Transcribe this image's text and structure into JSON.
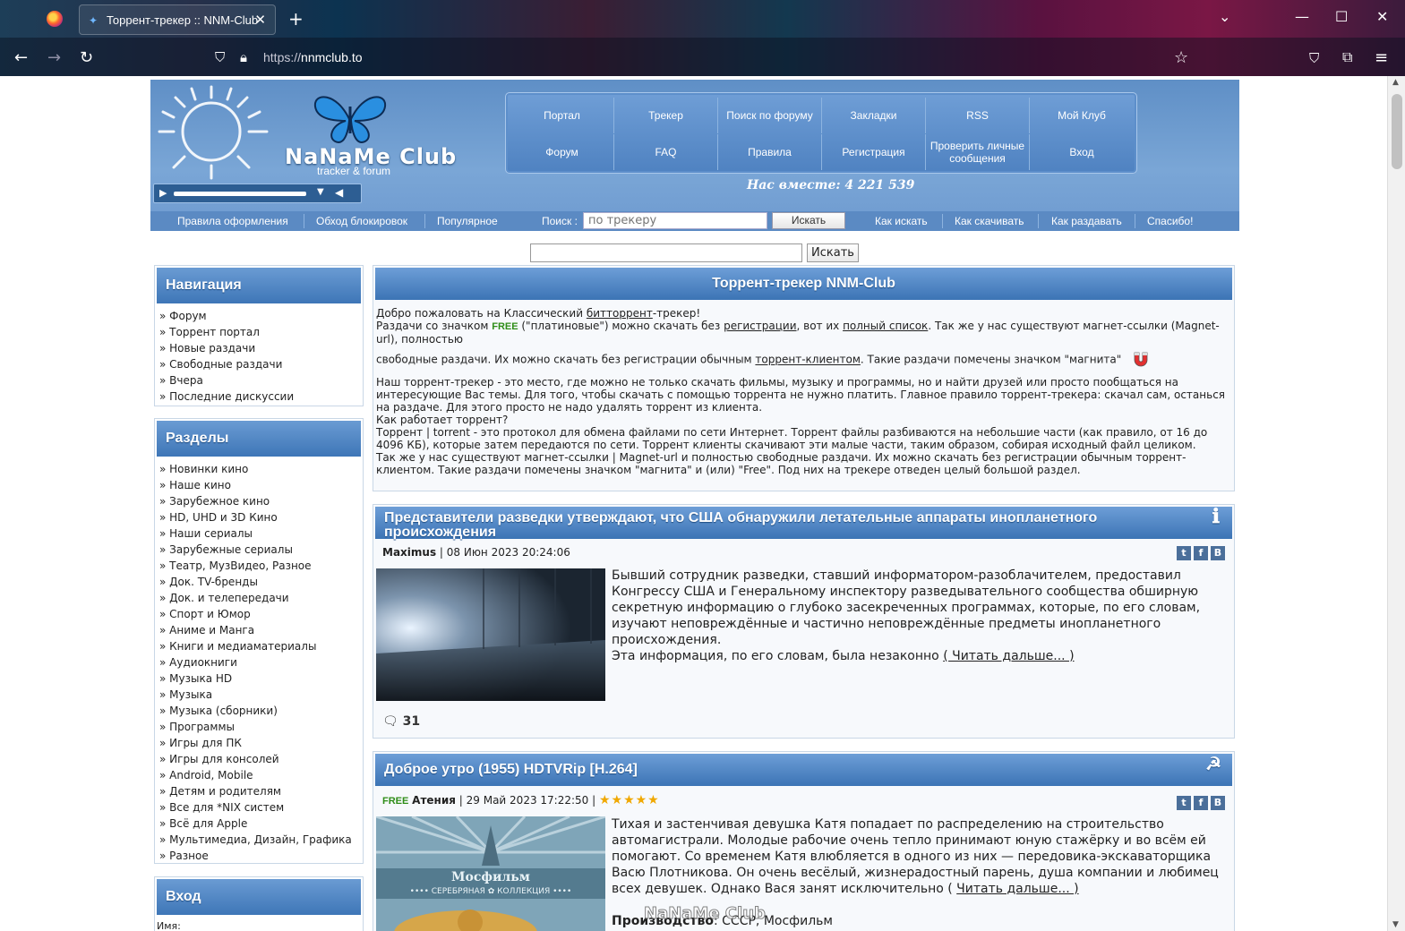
{
  "browser": {
    "tab_title": "Торрент-трекер :: NNM-Club",
    "url_proto": "https://",
    "url_host": "nnmclub.to"
  },
  "header": {
    "logo_text": "NaNaMe Club",
    "logo_sub": "tracker & forum",
    "menu_row1": [
      "Портал",
      "Трекер",
      "Поиск по форуму",
      "Закладки",
      "RSS",
      "Мой Клуб"
    ],
    "menu_row2": [
      "Форум",
      "FAQ",
      "Правила",
      "Регистрация",
      "Проверить личные сообщения",
      "Вход"
    ],
    "together": "Нас вместе: 4 221 539",
    "subbar_links": [
      "Правила оформления",
      "Обход блокировок",
      "Популярное"
    ],
    "search_label": "Поиск :",
    "search_placeholder": "по трекеру",
    "search_button": "Искать",
    "subbar_right": [
      "Как искать",
      "Как скачивать",
      "Как раздавать",
      "Спасибо!"
    ]
  },
  "top_search": {
    "button": "Искать"
  },
  "sidebar": {
    "nav_title": "Навигация",
    "nav_items": [
      "Форум",
      "Торрент портал",
      "Новые раздачи",
      "Свободные раздачи",
      "Вчера",
      "Последние дискуссии"
    ],
    "sections_title": "Разделы",
    "sections": [
      "Новинки кино",
      "Наше кино",
      "Зарубежное кино",
      "HD, UHD и 3D Кино",
      "Наши сериалы",
      "Зарубежные сериалы",
      "Театр, МузВидео, Разное",
      "Док. TV-бренды",
      "Док. и телепередачи",
      "Спорт и Юмор",
      "Аниме и Манга",
      "Книги и медиаматериалы",
      "Аудиокниги",
      "Музыка HD",
      "Музыка",
      "Музыка (сборники)",
      "Программы",
      "Игры для ПК",
      "Игры для консолей",
      "Android, Mobile",
      "Детям и родителям",
      "Все для *NIX систем",
      "Всё для Apple",
      "Мультимедиа, Дизайн, Графика",
      "Разное"
    ],
    "login_title": "Вход",
    "login_name_label": "Имя:"
  },
  "welcome": {
    "title": "Торрент-трекер NNM-Club",
    "l1a": "Добро пожаловать на Классический ",
    "l1link": "битторрент",
    "l1b": "-трекер!",
    "l2a": "Раздачи со значком ",
    "free": "FREE",
    "l2b": " (\"платиновые\") можно скачать без ",
    "l2link1": "регистрации",
    "l2c": ", вот их ",
    "l2link2": "полный список",
    "l2d": ". Так же у нас существуют магнет-ссылки (Magnet-url), полностью",
    "l3a": "свободные раздачи. Их можно скачать без регистрации обычным ",
    "l3link": "торрент-клиентом",
    "l3b": ". Такие раздачи помечены значком \"магнита\"",
    "p2": "Наш торрент-трекер - это место, где можно не только скачать фильмы, музыку и программы, но и найти друзей или просто пообщаться на интересующие Вас темы. Для того, чтобы скачать с помощью торрента не нужно платить. Главное правило торрент-трекера: скачал сам, останься на раздаче. Для этого просто не надо удалять торрент из клиента.",
    "p3": "Как работает торрент?",
    "p4": "Торрент | torrent - это протокол для обмена файлами по сети Интернет. Торрент файлы разбиваются на небольшие части (как правило, от 16 до 4096 КБ), которые затем передаются по сети. Торрент клиенты скачивают эти малые части, таким образом, собирая исходный файл целиком.",
    "p5": "Так же у нас существуют магнет-ссылки | Magnet-url и полностью свободные раздачи. Их можно скачать без регистрации обычным торрент-клиентом. Такие раздачи помечены значком \"магнита\" и (или) \"Free\". Под них на трекере отведен целый большой раздел."
  },
  "news1": {
    "title": "Представители разведки утверждают, что США обнаружили летательные аппараты инопланетного происхождения",
    "author": "Maximus",
    "date": "08 Июн 2023 20:24:06",
    "text": "Бывший сотрудник разведки, ставший информатором-разоблачителем, предоставил Конгрессу США и Генеральному инспектору разведывательного сообщества обширную секретную информацию о глубоко засекреченных программах, которые, по его словам, изучают неповреждённые и частично неповреждённые предметы инопланетного происхождения.",
    "text2": "Эта информация, по его словам, была незаконно ",
    "readmore": "( Читать дальше... )",
    "comments": "31"
  },
  "news2": {
    "title": "Доброе утро (1955) HDTVRip [H.264]",
    "free": "FREE",
    "author": "Атения",
    "date": "29 Май 2023 17:22:50",
    "stars": "★★★★★",
    "text": "Тихая и застенчивая девушка Катя попадает по распределению на строительство автомагистрали. Молодые рабочие очень тепло принимают юную стажёрку и во всём ей помогают. Со временем Катя влюбляется в одного из них — передовика-экскаваторщика Васю Плотникова. Он очень весёлый, жизнерадостный парень, душа компании и любимец всех девушек. Однако Вася занят исключительно ( ",
    "readmore": "Читать дальше... )",
    "prod_label": "Производство",
    "prod_value": ": СССР, Мосфильм",
    "poster_studio": "Мосфильм",
    "poster_collection": "•••• СЕРЕБРЯНАЯ ✿ КОЛЛЕКЦИЯ ••••",
    "watermark": "NaNaMe Club"
  },
  "share_icons": [
    "twitter-icon",
    "facebook-icon",
    "vk-icon"
  ]
}
